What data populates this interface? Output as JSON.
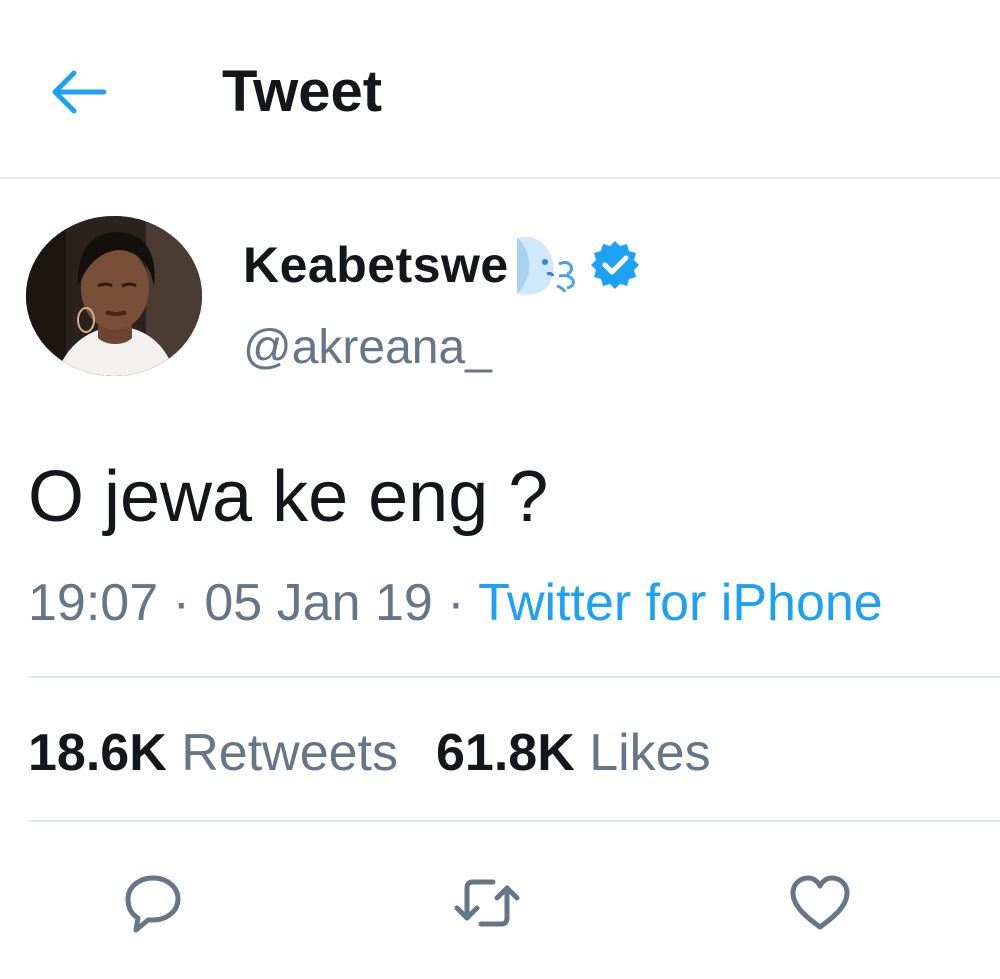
{
  "header": {
    "title": "Tweet",
    "back_icon": "arrow-left-icon"
  },
  "author": {
    "display_name": "Keabetswe",
    "name_emoji": "dashing-away-emoji",
    "verified": true,
    "handle": "@akreana_"
  },
  "tweet": {
    "text": "O jewa ke eng ?",
    "time": "19:07",
    "date": "05 Jan 19",
    "separator": "·",
    "source": "Twitter for iPhone"
  },
  "stats": {
    "retweets_count": "18.6K",
    "retweets_label": "Retweets",
    "likes_count": "61.8K",
    "likes_label": "Likes"
  },
  "actions": [
    "reply-icon",
    "retweet-icon",
    "like-icon"
  ],
  "colors": {
    "accent": "#1da1f2",
    "text": "#14171a",
    "secondary_text": "#657786",
    "divider": "#e1e8ed"
  }
}
